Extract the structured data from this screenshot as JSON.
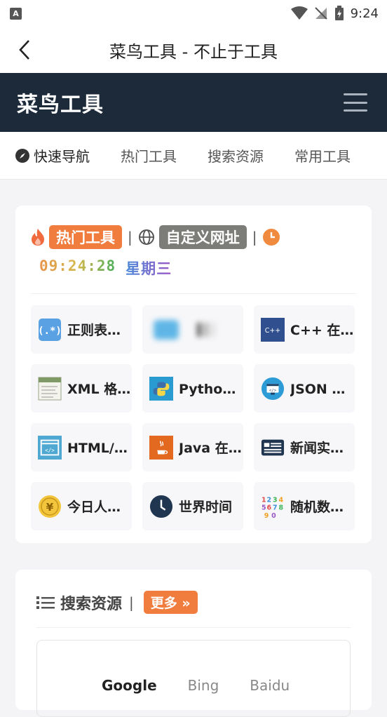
{
  "status_bar": {
    "time": "9:24",
    "left_icon_letter": "A"
  },
  "app_bar": {
    "title": "菜鸟工具 - 不止于工具"
  },
  "brand": {
    "name": "菜鸟工具"
  },
  "tabs": [
    {
      "label": "快速导航",
      "icon": "compass-icon"
    },
    {
      "label": "热门工具"
    },
    {
      "label": "搜索资源"
    },
    {
      "label": "常用工具"
    }
  ],
  "hot_card": {
    "hot_badge": "热门工具",
    "custom_badge": "自定义网址",
    "separator": "|",
    "time": "09:24:28",
    "weekday": "星期三",
    "tools": [
      {
        "label": "正则表达式在线测试",
        "icon": "regex-icon"
      },
      {
        "label": "",
        "icon": "blurred-icon"
      },
      {
        "label": "C++ 在线工具",
        "icon": "cpp-icon"
      },
      {
        "label": "XML 格式化",
        "icon": "xml-icon"
      },
      {
        "label": "Python 在线工具",
        "icon": "python-icon"
      },
      {
        "label": "JSON 在线解析",
        "icon": "json-icon"
      },
      {
        "label": "HTML/JS 在线工具",
        "icon": "html-icon"
      },
      {
        "label": "Java 在线工具",
        "icon": "java-icon"
      },
      {
        "label": "新闻实时热点",
        "icon": "news-icon"
      },
      {
        "label": "今日人民币汇率",
        "icon": "yuan-icon"
      },
      {
        "label": "世界时间",
        "icon": "clock-icon"
      },
      {
        "label": "随机数生成器",
        "icon": "random-numbers-icon"
      }
    ]
  },
  "search_card": {
    "title": "搜索资源",
    "separator": "|",
    "more": "更多 »",
    "engines": [
      "Google",
      "Bing",
      "Baidu"
    ]
  },
  "colors": {
    "brand_bar": "#1d2a3a",
    "accent_orange": "#f07c3e",
    "badge_gray": "#7c7c78"
  }
}
